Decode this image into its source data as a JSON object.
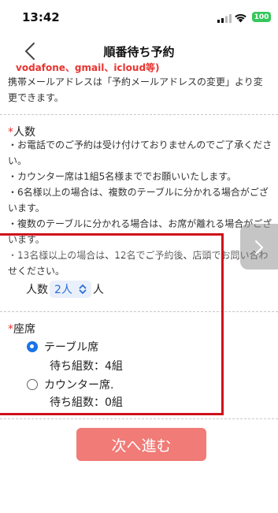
{
  "status_bar": {
    "time": "13:42",
    "battery": "100"
  },
  "nav": {
    "title": "順番待ち予約"
  },
  "email_section": {
    "cutoff_text": "vodafone、gmail、icloud等)",
    "note": "携帯メールアドレスは「予約メールアドレスの変更」より変更できます。"
  },
  "party_size": {
    "required_mark": "*",
    "title": "人数",
    "notes": [
      "・お電話でのご予約は受け付けておりませんのでご了承ください。",
      "・カウンター席は1組5名様まででお願いいたします。",
      "・6名様以上の場合は、複数のテーブルに分かれる場合がございます。",
      "・複数のテーブルに分かれる場合は、お席が離れる場合がございます。",
      "・13名様以上の場合は、12名でご予約後、店頭でお問い合わせください。"
    ],
    "label_before": "人数",
    "selected_value": "2人",
    "label_after": "人"
  },
  "seat": {
    "required_mark": "*",
    "title": "座席",
    "options": [
      {
        "label": "テーブル席",
        "wait": "待ち組数：4組",
        "checked": true
      },
      {
        "label": "カウンター席.",
        "wait": "待ち組数：0組",
        "checked": false
      }
    ]
  },
  "actions": {
    "next_label": "次へ進む"
  },
  "colors": {
    "accent": "#1a73e8",
    "required": "#e8342f",
    "next_button": "#f07470",
    "highlight": "#d0101a"
  }
}
